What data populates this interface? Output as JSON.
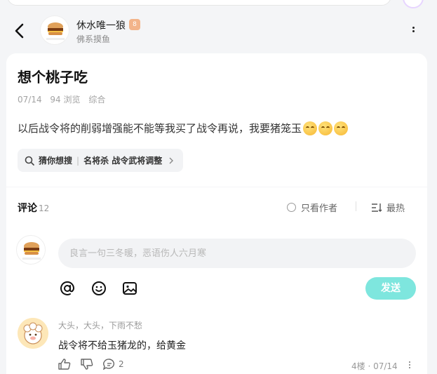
{
  "header": {
    "author_name": "休水唯一狼",
    "level_badge": "8",
    "author_subtitle": "佛系摸鱼"
  },
  "post": {
    "title": "想个桃子吃",
    "date": "07/14",
    "views": "94 浏览",
    "category": "综合",
    "body": "以后战令将的削弱增强能不能等我买了战令再说，我要猪笼玉",
    "emoji_count": 3,
    "guess_label": "猜你想搜",
    "guess_query": "名将杀 战令武将调整"
  },
  "comments_section": {
    "title": "评论",
    "count": "12",
    "only_author_label": "只看作者",
    "sort_label": "最热",
    "input_placeholder": "良言一句三冬暖，恶语伤人六月寒",
    "send_label": "发送"
  },
  "comment": {
    "user": "大头，大头，下雨不愁",
    "text": "战令将不给玉猪龙的，给黄金",
    "reply_count": "2",
    "floor_date": "4楼 · 07/14"
  },
  "colors": {
    "accent": "#7ee6de",
    "background": "#f4f5f7",
    "badge": "#f3b48a"
  }
}
